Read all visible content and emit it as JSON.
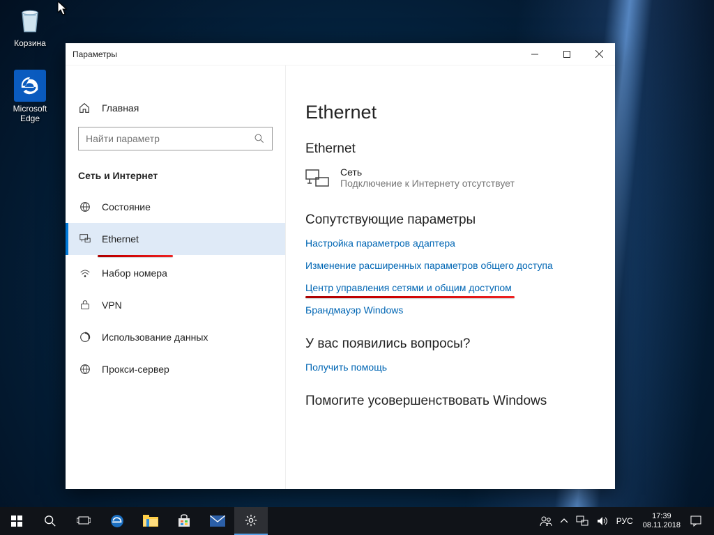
{
  "desktop": {
    "recycle_bin": "Корзина",
    "edge": "Microsoft Edge"
  },
  "window": {
    "title": "Параметры"
  },
  "sidebar": {
    "home": "Главная",
    "search_placeholder": "Найти параметр",
    "category": "Сеть и Интернет",
    "items": [
      {
        "label": "Состояние"
      },
      {
        "label": "Ethernet"
      },
      {
        "label": "Набор номера"
      },
      {
        "label": "VPN"
      },
      {
        "label": "Использование данных"
      },
      {
        "label": "Прокси-сервер"
      }
    ]
  },
  "content": {
    "title": "Ethernet",
    "subtitle": "Ethernet",
    "net_name": "Сеть",
    "net_status": "Подключение к Интернету отсутствует",
    "related_heading": "Сопутствующие параметры",
    "links": [
      "Настройка параметров адаптера",
      "Изменение расширенных параметров общего доступа",
      "Центр управления сетями и общим доступом",
      "Брандмауэр Windows"
    ],
    "help_heading": "У вас появились вопросы?",
    "help_link": "Получить помощь",
    "improve_heading": "Помогите усовершенствовать Windows"
  },
  "taskbar": {
    "lang": "РУС",
    "time": "17:39",
    "date": "08.11.2018"
  }
}
